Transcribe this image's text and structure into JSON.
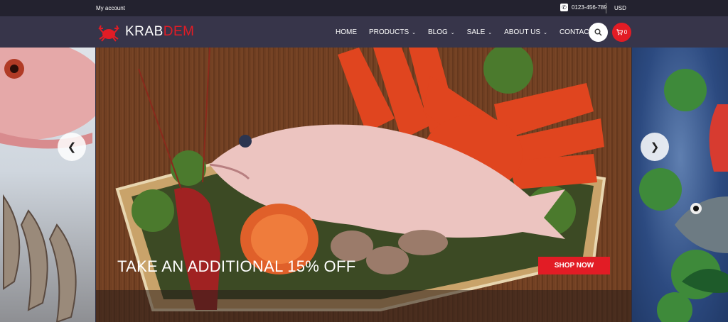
{
  "topbar": {
    "account_label": "My account",
    "phone": "0123-456-789",
    "currency": "USD"
  },
  "header": {
    "logo_part1": "KRAB",
    "logo_part2": "DEM",
    "nav": [
      {
        "label": "HOME",
        "has_dropdown": false
      },
      {
        "label": "PRODUCTS",
        "has_dropdown": true
      },
      {
        "label": "BLOG",
        "has_dropdown": true
      },
      {
        "label": "SALE",
        "has_dropdown": true
      },
      {
        "label": "ABOUT US",
        "has_dropdown": true
      },
      {
        "label": "CONTACT US",
        "has_dropdown": false
      }
    ],
    "cart_count": "0",
    "search_icon": "search-icon",
    "cart_icon": "cart-icon"
  },
  "slider": {
    "promo_text": "TAKE AN ADDITIONAL 15% OFF",
    "cta_label": "SHOP NOW",
    "prev_icon": "chevron-left-icon",
    "next_icon": "chevron-right-icon"
  },
  "colors": {
    "accent": "#e21c25",
    "topbar_bg": "#23222f",
    "header_bg": "#37354a"
  }
}
